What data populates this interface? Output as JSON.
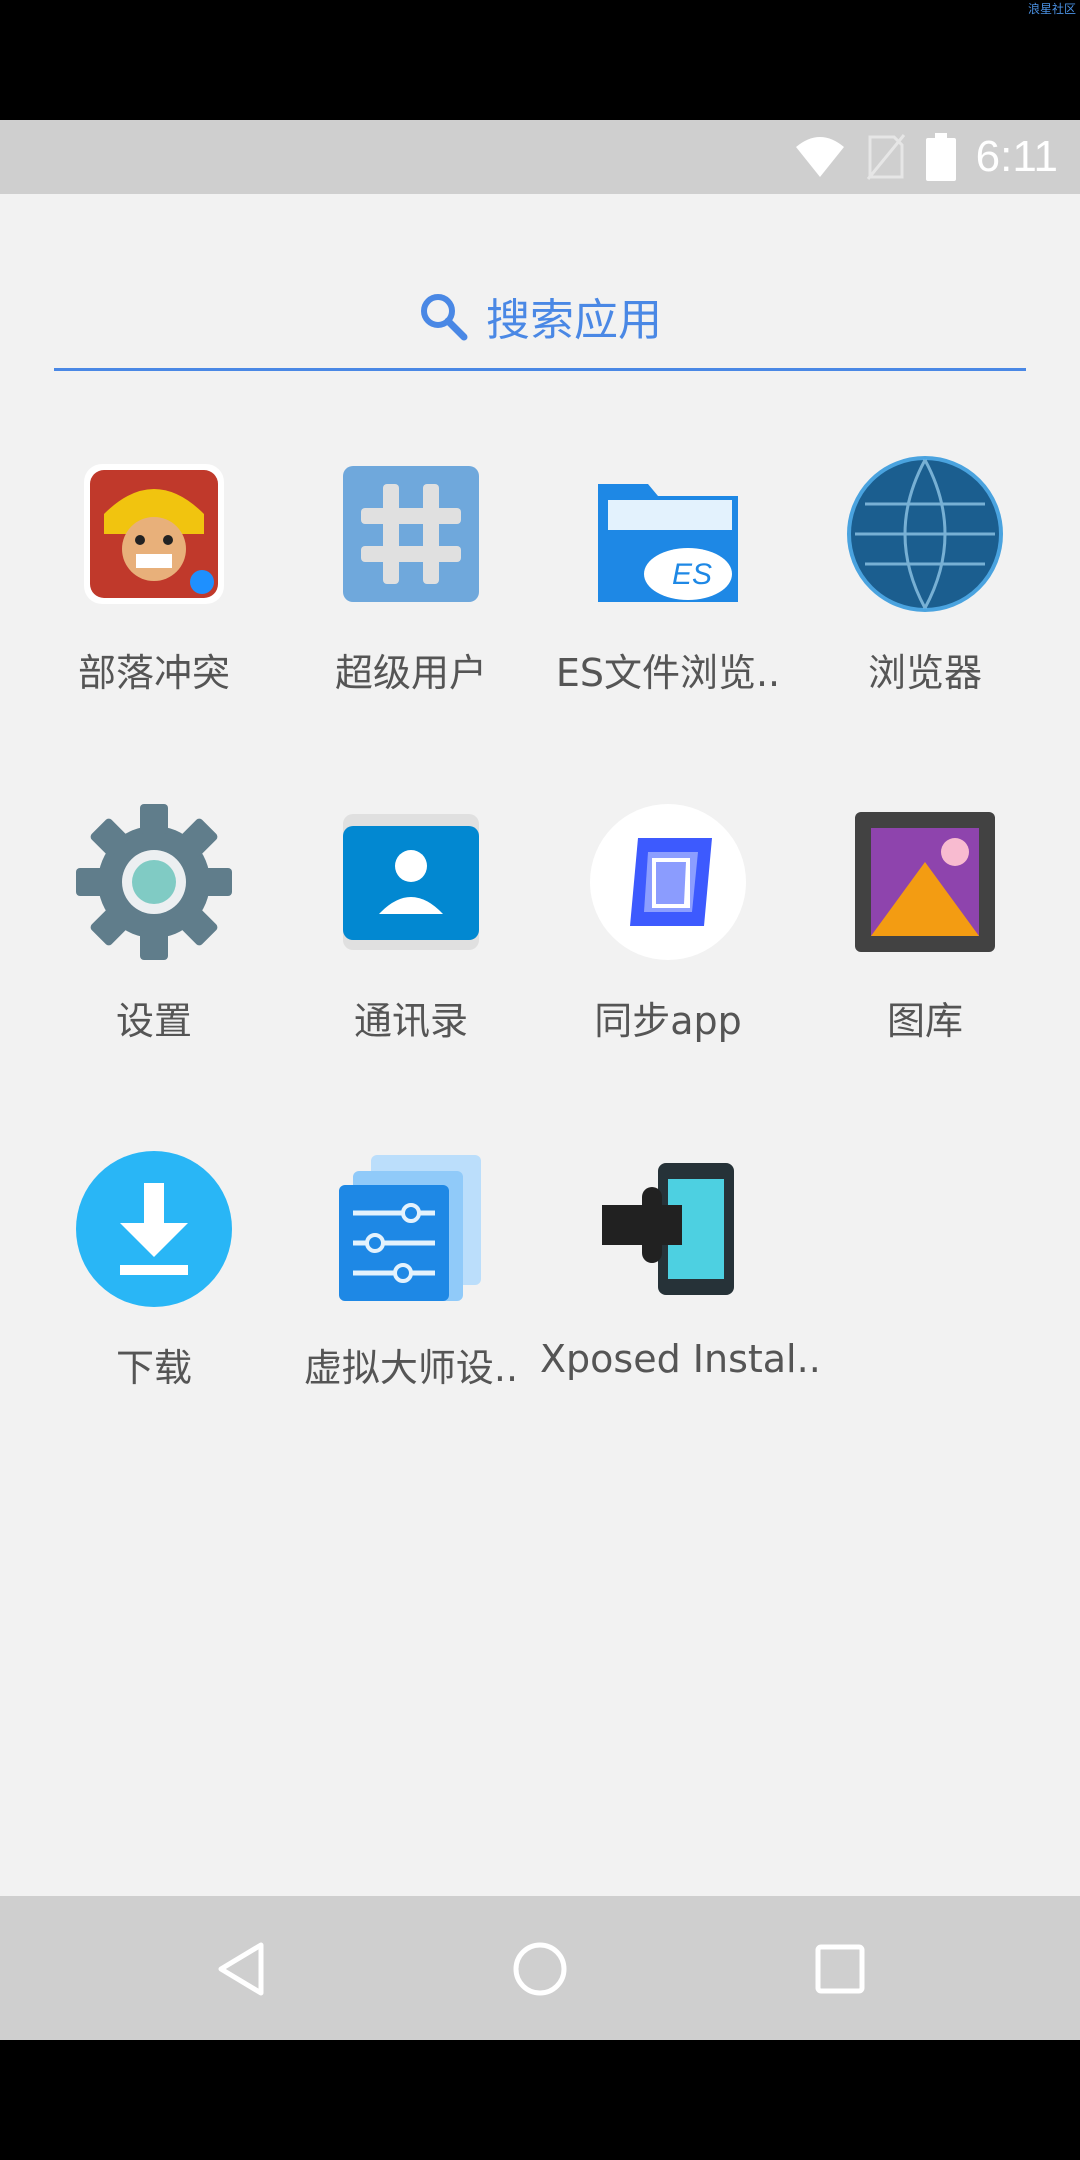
{
  "watermark": "浪星社区",
  "status_bar": {
    "time": "6:11"
  },
  "search": {
    "label": "搜索应用"
  },
  "apps": [
    {
      "label": "部落冲突",
      "icon": "clash-of-clans-icon"
    },
    {
      "label": "超级用户",
      "icon": "superuser-icon"
    },
    {
      "label": "ES文件浏览..",
      "icon": "es-file-explorer-icon"
    },
    {
      "label": "浏览器",
      "icon": "browser-globe-icon"
    },
    {
      "label": "设置",
      "icon": "settings-gear-icon"
    },
    {
      "label": "通讯录",
      "icon": "contacts-icon"
    },
    {
      "label": "同步app",
      "icon": "sync-app-cube-icon"
    },
    {
      "label": "图库",
      "icon": "gallery-icon"
    },
    {
      "label": "下载",
      "icon": "download-icon"
    },
    {
      "label": "虚拟大师设..",
      "icon": "virtual-master-settings-icon"
    },
    {
      "label": "Xposed Instal..",
      "icon": "xposed-installer-icon"
    }
  ],
  "nav": {
    "back": "back-icon",
    "home": "home-icon",
    "recents": "recents-icon"
  }
}
